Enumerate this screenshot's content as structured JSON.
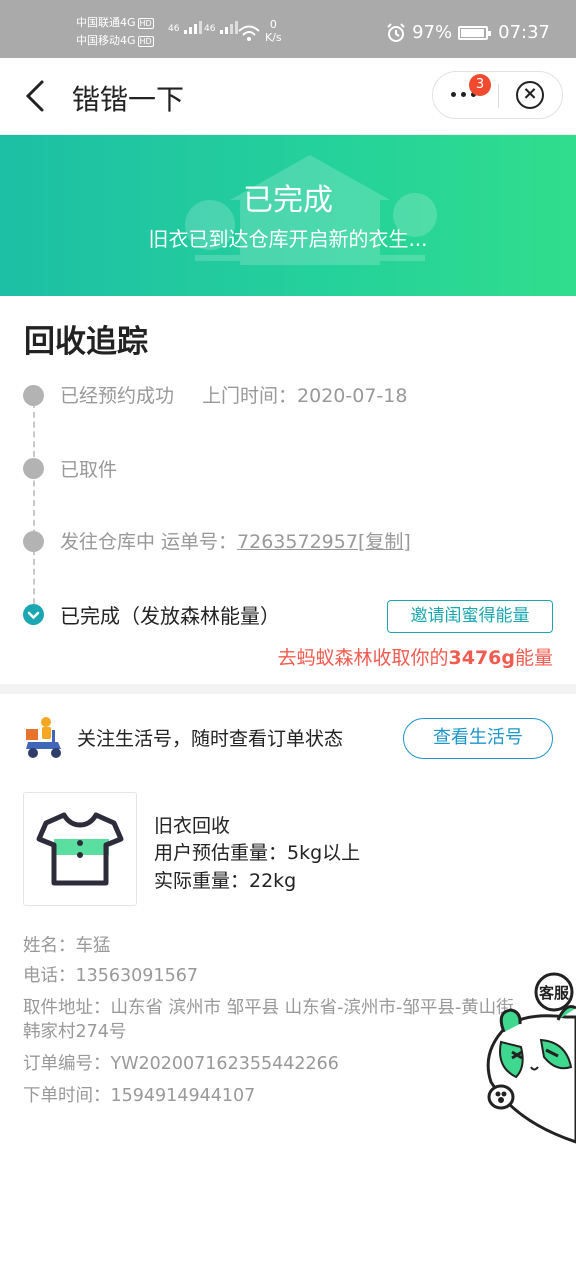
{
  "status_bar": {
    "carrier1": "中国联通4G",
    "carrier2": "中国移动4G",
    "hd_label": "HD",
    "signal1": "46",
    "signal2": "46",
    "net_speed_value": "0",
    "net_speed_unit": "K/s",
    "battery": "97%",
    "battery_level": 0.97,
    "time": "07:37"
  },
  "header": {
    "title": "锴锴一下",
    "notification_count": "3"
  },
  "banner": {
    "title": "已完成",
    "subtitle": "旧衣已到达仓库开启新的衣生..."
  },
  "tracking": {
    "section_title": "回收追踪",
    "steps": [
      {
        "label": "已经预约成功",
        "detail": "上门时间：2020-07-18"
      },
      {
        "label": "已取件"
      },
      {
        "label": "发往仓库中 运单号：",
        "tracking_no": "7263572957",
        "copy_label": "[复制]"
      },
      {
        "label": "已完成（发放森林能量）"
      }
    ],
    "invite_button": "邀请闺蜜得能量",
    "energy_prefix": "去蚂蚁森林收取你的",
    "energy_amount": "3476g",
    "energy_suffix": "能量"
  },
  "follow": {
    "text": "关注生活号，随时查看订单状态",
    "button": "查看生活号"
  },
  "product": {
    "name": "旧衣回收",
    "estimated_weight": "用户预估重量：5kg以上",
    "actual_weight": "实际重量：22kg"
  },
  "order_info": {
    "name": "姓名：车猛",
    "phone": "电话：13563091567",
    "address_line1": "取件地址：山东省 滨州市 邹平县 山东省-滨州市-邹平县-黄山街",
    "address_line2": "韩家村274号",
    "order_no": "订单编号：YW202007162355442266",
    "order_time": "下单时间：1594914944107"
  },
  "customer_service": {
    "label": "客服"
  },
  "colors": {
    "banner_start": "#1dbfa5",
    "banner_end": "#30dd8c",
    "accent_teal": "#1ba7b2",
    "accent_blue": "#1d96c9",
    "energy_red": "#f25b4f",
    "badge_red": "#f04a2f"
  }
}
